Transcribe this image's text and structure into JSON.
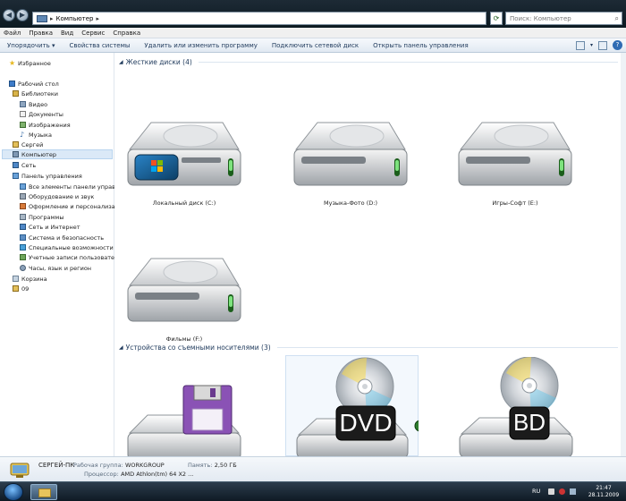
{
  "address": {
    "root": "Компьютер",
    "search_placeholder": "Поиск: Компьютер"
  },
  "menu": [
    "Файл",
    "Правка",
    "Вид",
    "Сервис",
    "Справка"
  ],
  "toolbar": [
    "Упорядочить ▾",
    "Свойства системы",
    "Удалить или изменить программу",
    "Подключить сетевой диск",
    "Открыть панель управления"
  ],
  "nav": {
    "favorites": "Избранное",
    "desktop": "Рабочий стол",
    "libraries": "Библиотеки",
    "video": "Видео",
    "documents": "Документы",
    "images": "Изображения",
    "music": "Музыка",
    "user": "Сергей",
    "computer": "Компьютер",
    "network": "Сеть",
    "control_panel": "Панель управления",
    "cp_items": [
      "Все элементы панели управления",
      "Оборудование и звук",
      "Оформление и персонализация",
      "Программы",
      "Сеть и Интернет",
      "Система и безопасность",
      "Специальные возможности",
      "Учетные записи пользователей",
      "Часы, язык и регион"
    ],
    "recycle": "Корзина",
    "folder09": "09"
  },
  "groups": {
    "hdd_title": "Жесткие диски (4)",
    "removable_title": "Устройства со съемными носителями (3)"
  },
  "drives": [
    {
      "label": "Локальный диск (C:)"
    },
    {
      "label": "Музыка-Фото (D:)"
    },
    {
      "label": "Игры-Софт (E:)"
    },
    {
      "label": "Фильмы (F:)"
    }
  ],
  "removable": [
    {
      "badge": ""
    },
    {
      "badge": "DVD"
    },
    {
      "badge": "BD"
    }
  ],
  "details": {
    "pc_name": "СЕРГЕЙ-ПК",
    "workgroup_label": "Рабочая группа:",
    "workgroup": "WORKGROUP",
    "memory_label": "Память:",
    "memory": "2,50 ГБ",
    "cpu_label": "Процессор:",
    "cpu": "AMD Athlon(tm) 64 X2 ..."
  },
  "taskbar": {
    "lang": "RU",
    "time": "21:47",
    "date": "28.11.2009"
  }
}
